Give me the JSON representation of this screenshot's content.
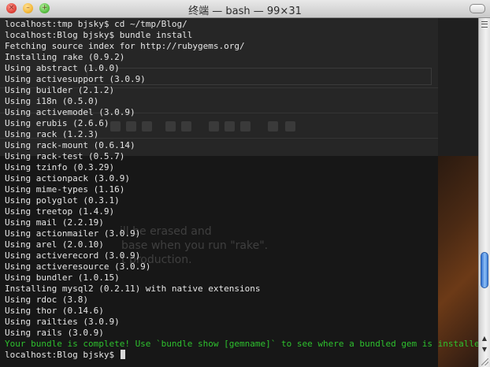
{
  "window": {
    "title": "终端 — bash — 99×31"
  },
  "terminal": {
    "prompt_final": "localhost:Blog bjsky$ ",
    "lines": [
      {
        "text": "localhost:tmp bjsky$ cd ~/tmp/Blog/",
        "color": "default"
      },
      {
        "text": "localhost:Blog bjsky$ bundle install",
        "color": "default"
      },
      {
        "text": "Fetching source index for http://rubygems.org/",
        "color": "default"
      },
      {
        "text": "Installing rake (0.9.2)",
        "color": "default"
      },
      {
        "text": "Using abstract (1.0.0)",
        "color": "default"
      },
      {
        "text": "Using activesupport (3.0.9)",
        "color": "default"
      },
      {
        "text": "Using builder (2.1.2)",
        "color": "default"
      },
      {
        "text": "Using i18n (0.5.0)",
        "color": "default"
      },
      {
        "text": "Using activemodel (3.0.9)",
        "color": "default"
      },
      {
        "text": "Using erubis (2.6.6)",
        "color": "default"
      },
      {
        "text": "Using rack (1.2.3)",
        "color": "default"
      },
      {
        "text": "Using rack-mount (0.6.14)",
        "color": "default"
      },
      {
        "text": "Using rack-test (0.5.7)",
        "color": "default"
      },
      {
        "text": "Using tzinfo (0.3.29)",
        "color": "default"
      },
      {
        "text": "Using actionpack (3.0.9)",
        "color": "default"
      },
      {
        "text": "Using mime-types (1.16)",
        "color": "default"
      },
      {
        "text": "Using polyglot (0.3.1)",
        "color": "default"
      },
      {
        "text": "Using treetop (1.4.9)",
        "color": "default"
      },
      {
        "text": "Using mail (2.2.19)",
        "color": "default"
      },
      {
        "text": "Using actionmailer (3.0.9)",
        "color": "default"
      },
      {
        "text": "Using arel (2.0.10)",
        "color": "default"
      },
      {
        "text": "Using activerecord (3.0.9)",
        "color": "default"
      },
      {
        "text": "Using activeresource (3.0.9)",
        "color": "default"
      },
      {
        "text": "Using bundler (1.0.15)",
        "color": "default"
      },
      {
        "text": "Installing mysql2 (0.2.11) with native extensions",
        "color": "default"
      },
      {
        "text": "Using rdoc (3.8)",
        "color": "default"
      },
      {
        "text": "Using thor (0.14.6)",
        "color": "default"
      },
      {
        "text": "Using railties (3.0.9)",
        "color": "default"
      },
      {
        "text": "Using rails (3.0.9)",
        "color": "default"
      },
      {
        "text": "Your bundle is complete! Use `bundle show [gemname]` to see where a bundled gem is installed.",
        "color": "green"
      }
    ]
  },
  "background_app": {
    "text_lines": [
      "ill be erased and",
      "base when you run \"rake\".",
      "t production."
    ]
  },
  "colors": {
    "terminal_background": "#171717",
    "terminal_text": "#e6e6e6",
    "success_text": "#2ec12e",
    "scroll_thumb": "#3f7fd8"
  },
  "scrollbar": {
    "position_fraction": 0.84
  },
  "icons": [
    "close-button",
    "minimize-button",
    "zoom-button",
    "toolbar-toggle",
    "scroll-up-icon",
    "scroll-down-icon",
    "resize-grip-icon"
  ]
}
